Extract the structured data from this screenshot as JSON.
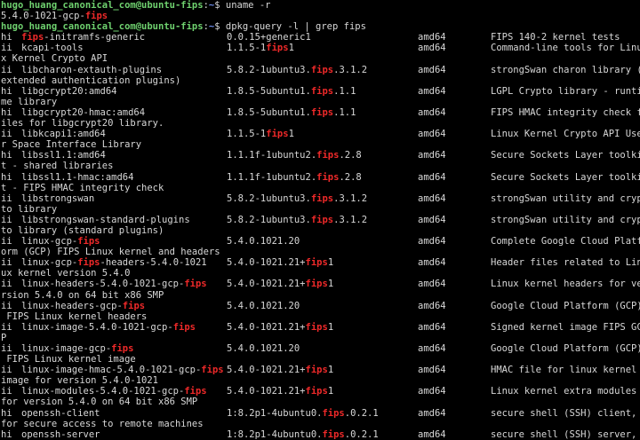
{
  "colors": {
    "background": "#000000",
    "text": "#d8d8d8",
    "prompt_user": "#6fd16f",
    "prompt_path": "#6f8ff0",
    "highlight": "#ef2929"
  },
  "highlight_term": "fips",
  "lines": [
    {
      "kind": "prompt",
      "user": "hugo_huang_canonical_com@ubuntu-fips",
      "sep": ":",
      "path": "~",
      "symbol": "$ ",
      "cmd": "uname -r"
    },
    {
      "kind": "text",
      "text": "5.4.0-1021-gcp-fips"
    },
    {
      "kind": "prompt",
      "user": "hugo_huang_canonical_com@ubuntu-fips",
      "sep": ":",
      "path": "~",
      "symbol": "$ ",
      "cmd": "dpkg-query -l | grep fips"
    },
    {
      "kind": "row",
      "status": "hi",
      "name": "fips-initramfs-generic",
      "version": "0.0.15+generic1",
      "arch": "amd64",
      "desc": "FIPS 140-2 kernel tests"
    },
    {
      "kind": "row",
      "status": "ii",
      "name": "kcapi-tools",
      "version": "1.1.5-1fips1",
      "arch": "amd64",
      "desc": "Command-line tools for Linux"
    },
    {
      "kind": "text",
      "text": "x Kernel Crypto API"
    },
    {
      "kind": "row",
      "status": "ii",
      "name": "libcharon-extauth-plugins",
      "version": "5.8.2-1ubuntu3.fips.3.1.2",
      "arch": "amd64",
      "desc": "strongSwan charon library ("
    },
    {
      "kind": "text",
      "text": "extended authentication plugins)"
    },
    {
      "kind": "row",
      "status": "hi",
      "name": "libgcrypt20:amd64",
      "version": "1.8.5-5ubuntu1.fips.1.1",
      "arch": "amd64",
      "desc": "LGPL Crypto library - runti"
    },
    {
      "kind": "text",
      "text": "me library"
    },
    {
      "kind": "row",
      "status": "hi",
      "name": "libgcrypt20-hmac:amd64",
      "version": "1.8.5-5ubuntu1.fips.1.1",
      "arch": "amd64",
      "desc": "FIPS HMAC integrity check f"
    },
    {
      "kind": "text",
      "text": "iles for libgcrypt20 library."
    },
    {
      "kind": "row",
      "status": "ii",
      "name": "libkcapi1:amd64",
      "version": "1.1.5-1fips1",
      "arch": "amd64",
      "desc": "Linux Kernel Crypto API Use"
    },
    {
      "kind": "text",
      "text": "r Space Interface Library"
    },
    {
      "kind": "row",
      "status": "hi",
      "name": "libssl1.1:amd64",
      "version": "1.1.1f-1ubuntu2.fips.2.8",
      "arch": "amd64",
      "desc": "Secure Sockets Layer toolki"
    },
    {
      "kind": "text",
      "text": "t - shared libraries"
    },
    {
      "kind": "row",
      "status": "hi",
      "name": "libssl1.1-hmac:amd64",
      "version": "1.1.1f-1ubuntu2.fips.2.8",
      "arch": "amd64",
      "desc": "Secure Sockets Layer toolki"
    },
    {
      "kind": "text",
      "text": "t - FIPS HMAC integrity check"
    },
    {
      "kind": "row",
      "status": "ii",
      "name": "libstrongswan",
      "version": "5.8.2-1ubuntu3.fips.3.1.2",
      "arch": "amd64",
      "desc": "strongSwan utility and cryp"
    },
    {
      "kind": "text",
      "text": "to library"
    },
    {
      "kind": "row",
      "status": "ii",
      "name": "libstrongswan-standard-plugins",
      "version": "5.8.2-1ubuntu3.fips.3.1.2",
      "arch": "amd64",
      "desc": "strongSwan utility and cryp"
    },
    {
      "kind": "text",
      "text": "to library (standard plugins)"
    },
    {
      "kind": "row",
      "status": "ii",
      "name": "linux-gcp-fips",
      "version": "5.4.0.1021.20",
      "arch": "amd64",
      "desc": "Complete Google Cloud Platf"
    },
    {
      "kind": "text",
      "text": "orm (GCP) FIPS Linux kernel and headers"
    },
    {
      "kind": "row",
      "status": "ii",
      "name": "linux-gcp-fips-headers-5.4.0-1021",
      "version": "5.4.0-1021.21+fips1",
      "arch": "amd64",
      "desc": "Header files related to Lin"
    },
    {
      "kind": "text",
      "text": "ux kernel version 5.4.0"
    },
    {
      "kind": "row",
      "status": "ii",
      "name": "linux-headers-5.4.0-1021-gcp-fips",
      "version": "5.4.0-1021.21+fips1",
      "arch": "amd64",
      "desc": "Linux kernel headers for ve"
    },
    {
      "kind": "text",
      "text": "rsion 5.4.0 on 64 bit x86 SMP"
    },
    {
      "kind": "row",
      "status": "ii",
      "name": "linux-headers-gcp-fips",
      "version": "5.4.0.1021.20",
      "arch": "amd64",
      "desc": "Google Cloud Platform (GCP)"
    },
    {
      "kind": "text",
      "text": " FIPS Linux kernel headers"
    },
    {
      "kind": "row",
      "status": "ii",
      "name": "linux-image-5.4.0-1021-gcp-fips",
      "version": "5.4.0-1021.21+fips1",
      "arch": "amd64",
      "desc": "Signed kernel image FIPS GC"
    },
    {
      "kind": "text",
      "text": "P"
    },
    {
      "kind": "row",
      "status": "ii",
      "name": "linux-image-gcp-fips",
      "version": "5.4.0.1021.20",
      "arch": "amd64",
      "desc": "Google Cloud Platform (GCP)"
    },
    {
      "kind": "text",
      "text": " FIPS Linux kernel image"
    },
    {
      "kind": "row",
      "status": "ii",
      "name": "linux-image-hmac-5.4.0-1021-gcp-fips",
      "version": "5.4.0-1021.21+fips1",
      "arch": "amd64",
      "desc": "HMAC file for linux kernel "
    },
    {
      "kind": "text",
      "text": "image for version 5.4.0-1021"
    },
    {
      "kind": "row",
      "status": "ii",
      "name": "linux-modules-5.4.0-1021-gcp-fips",
      "version": "5.4.0-1021.21+fips1",
      "arch": "amd64",
      "desc": "Linux kernel extra modules "
    },
    {
      "kind": "text",
      "text": "for version 5.4.0 on 64 bit x86 SMP"
    },
    {
      "kind": "row",
      "status": "hi",
      "name": "openssh-client",
      "version": "1:8.2p1-4ubuntu0.fips.0.2.1",
      "arch": "amd64",
      "desc": "secure shell (SSH) client, "
    },
    {
      "kind": "text",
      "text": "for secure access to remote machines"
    },
    {
      "kind": "row",
      "status": "hi",
      "name": "openssh-server",
      "version": "1:8.2p1-4ubuntu0.fips.0.2.1",
      "arch": "amd64",
      "desc": "secure shell (SSH) server, "
    }
  ]
}
